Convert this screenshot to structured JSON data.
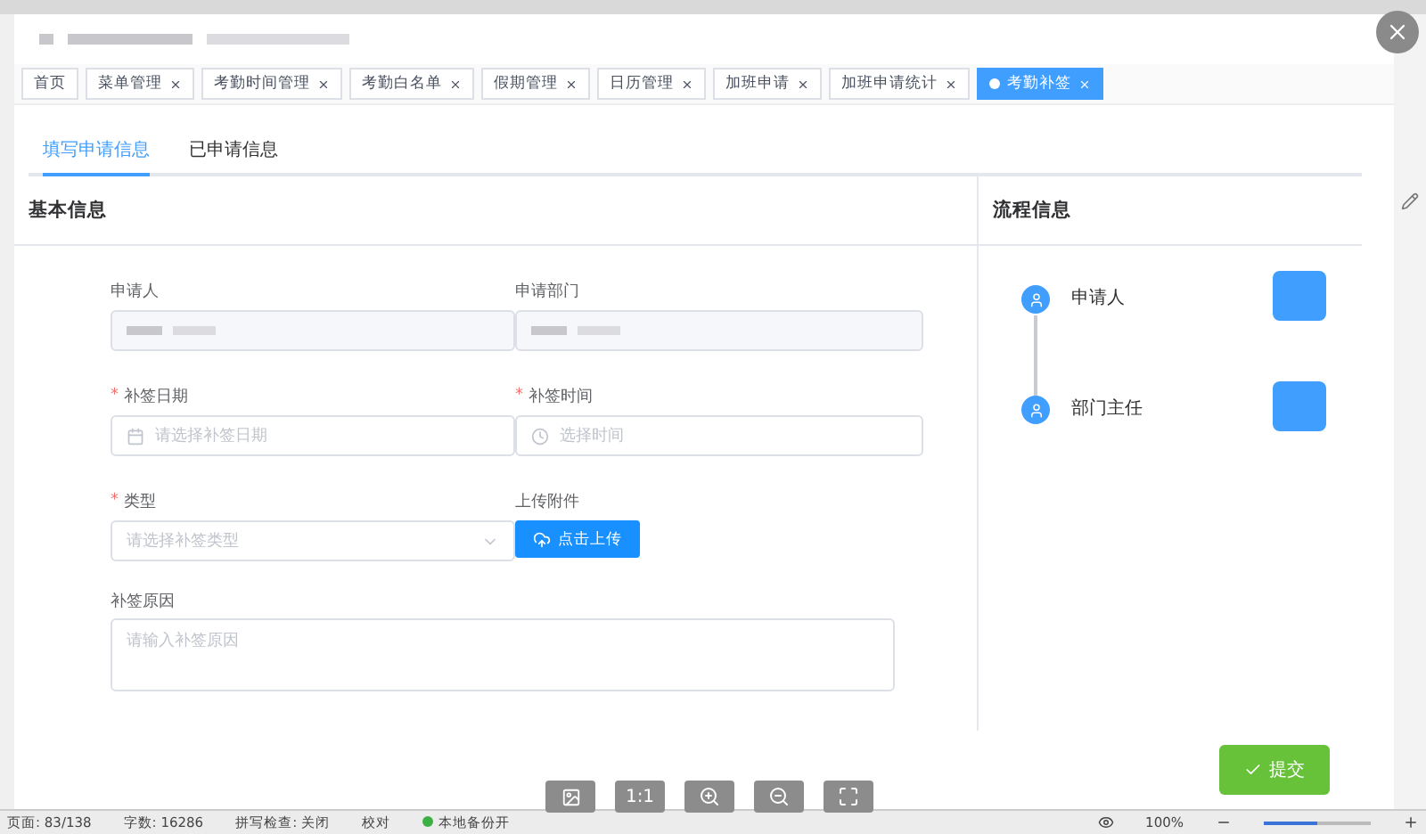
{
  "tags": [
    {
      "label": "首页",
      "selected": false,
      "closable": false
    },
    {
      "label": "菜单管理",
      "selected": false,
      "closable": true
    },
    {
      "label": "考勤时间管理",
      "selected": false,
      "closable": true
    },
    {
      "label": "考勤白名单",
      "selected": false,
      "closable": true
    },
    {
      "label": "假期管理",
      "selected": false,
      "closable": true
    },
    {
      "label": "日历管理",
      "selected": false,
      "closable": true
    },
    {
      "label": "加班申请",
      "selected": false,
      "closable": true
    },
    {
      "label": "加班申请统计",
      "selected": false,
      "closable": true
    },
    {
      "label": "考勤补签",
      "selected": true,
      "closable": true
    }
  ],
  "form_tabs": [
    {
      "label": "填写申请信息",
      "selected": true
    },
    {
      "label": "已申请信息",
      "selected": false
    }
  ],
  "basic_section": {
    "title": "基本信息",
    "fields": [
      {
        "kind": "readonly",
        "label": "申请人",
        "required": false
      },
      {
        "kind": "readonly",
        "label": "申请部门",
        "required": false
      },
      {
        "kind": "date",
        "label": "补签日期",
        "required": true,
        "required_mark": "*",
        "placeholder": "请选择补签日期"
      },
      {
        "kind": "time",
        "label": "补签时间",
        "required": true,
        "required_mark": "*",
        "placeholder": "选择时间"
      },
      {
        "kind": "select",
        "label": "类型",
        "required": true,
        "required_mark": "*",
        "placeholder": "请选择补签类型"
      },
      {
        "kind": "upload",
        "label": "上传附件",
        "required": false,
        "button_label": "点击上传"
      },
      {
        "kind": "textarea",
        "label": "补签原因",
        "required": false,
        "placeholder": "请输入补签原因"
      }
    ]
  },
  "flow_section": {
    "title": "流程信息",
    "steps": [
      {
        "label": "申请人"
      },
      {
        "label": "部门主任"
      }
    ]
  },
  "submit_button": "提交",
  "viewer_toolbar": {
    "actual_size_label": "1:1"
  },
  "status_bar": {
    "items": [
      "页面: 83/138",
      "字数: 16286",
      "拼写检查: 关闭",
      "校对",
      "本地备份开"
    ],
    "zoom": "100%",
    "zoom_slider": {
      "level": 0.5
    }
  }
}
